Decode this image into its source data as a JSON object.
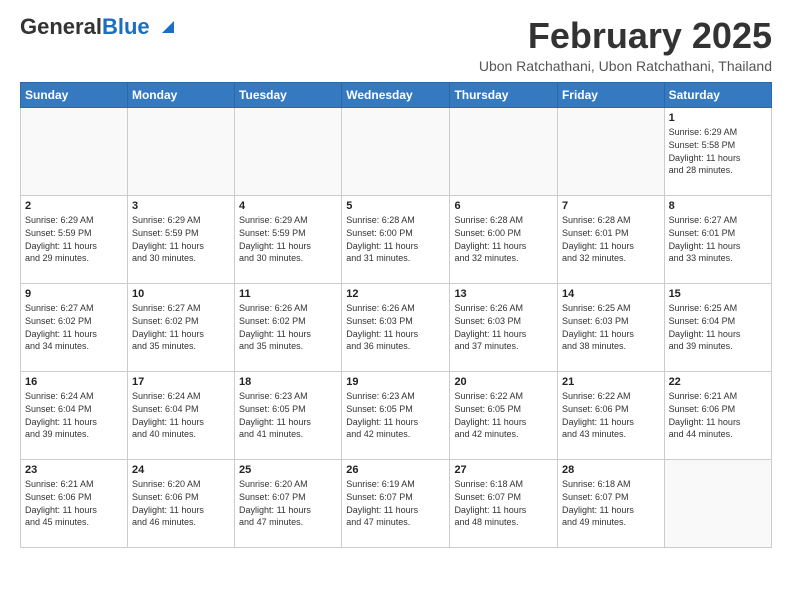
{
  "logo": {
    "general": "General",
    "blue": "Blue"
  },
  "title": "February 2025",
  "subtitle": "Ubon Ratchathani, Ubon Ratchathani, Thailand",
  "weekdays": [
    "Sunday",
    "Monday",
    "Tuesday",
    "Wednesday",
    "Thursday",
    "Friday",
    "Saturday"
  ],
  "weeks": [
    [
      {
        "day": "",
        "info": ""
      },
      {
        "day": "",
        "info": ""
      },
      {
        "day": "",
        "info": ""
      },
      {
        "day": "",
        "info": ""
      },
      {
        "day": "",
        "info": ""
      },
      {
        "day": "",
        "info": ""
      },
      {
        "day": "1",
        "info": "Sunrise: 6:29 AM\nSunset: 5:58 PM\nDaylight: 11 hours\nand 28 minutes."
      }
    ],
    [
      {
        "day": "2",
        "info": "Sunrise: 6:29 AM\nSunset: 5:59 PM\nDaylight: 11 hours\nand 29 minutes."
      },
      {
        "day": "3",
        "info": "Sunrise: 6:29 AM\nSunset: 5:59 PM\nDaylight: 11 hours\nand 30 minutes."
      },
      {
        "day": "4",
        "info": "Sunrise: 6:29 AM\nSunset: 5:59 PM\nDaylight: 11 hours\nand 30 minutes."
      },
      {
        "day": "5",
        "info": "Sunrise: 6:28 AM\nSunset: 6:00 PM\nDaylight: 11 hours\nand 31 minutes."
      },
      {
        "day": "6",
        "info": "Sunrise: 6:28 AM\nSunset: 6:00 PM\nDaylight: 11 hours\nand 32 minutes."
      },
      {
        "day": "7",
        "info": "Sunrise: 6:28 AM\nSunset: 6:01 PM\nDaylight: 11 hours\nand 32 minutes."
      },
      {
        "day": "8",
        "info": "Sunrise: 6:27 AM\nSunset: 6:01 PM\nDaylight: 11 hours\nand 33 minutes."
      }
    ],
    [
      {
        "day": "9",
        "info": "Sunrise: 6:27 AM\nSunset: 6:02 PM\nDaylight: 11 hours\nand 34 minutes."
      },
      {
        "day": "10",
        "info": "Sunrise: 6:27 AM\nSunset: 6:02 PM\nDaylight: 11 hours\nand 35 minutes."
      },
      {
        "day": "11",
        "info": "Sunrise: 6:26 AM\nSunset: 6:02 PM\nDaylight: 11 hours\nand 35 minutes."
      },
      {
        "day": "12",
        "info": "Sunrise: 6:26 AM\nSunset: 6:03 PM\nDaylight: 11 hours\nand 36 minutes."
      },
      {
        "day": "13",
        "info": "Sunrise: 6:26 AM\nSunset: 6:03 PM\nDaylight: 11 hours\nand 37 minutes."
      },
      {
        "day": "14",
        "info": "Sunrise: 6:25 AM\nSunset: 6:03 PM\nDaylight: 11 hours\nand 38 minutes."
      },
      {
        "day": "15",
        "info": "Sunrise: 6:25 AM\nSunset: 6:04 PM\nDaylight: 11 hours\nand 39 minutes."
      }
    ],
    [
      {
        "day": "16",
        "info": "Sunrise: 6:24 AM\nSunset: 6:04 PM\nDaylight: 11 hours\nand 39 minutes."
      },
      {
        "day": "17",
        "info": "Sunrise: 6:24 AM\nSunset: 6:04 PM\nDaylight: 11 hours\nand 40 minutes."
      },
      {
        "day": "18",
        "info": "Sunrise: 6:23 AM\nSunset: 6:05 PM\nDaylight: 11 hours\nand 41 minutes."
      },
      {
        "day": "19",
        "info": "Sunrise: 6:23 AM\nSunset: 6:05 PM\nDaylight: 11 hours\nand 42 minutes."
      },
      {
        "day": "20",
        "info": "Sunrise: 6:22 AM\nSunset: 6:05 PM\nDaylight: 11 hours\nand 42 minutes."
      },
      {
        "day": "21",
        "info": "Sunrise: 6:22 AM\nSunset: 6:06 PM\nDaylight: 11 hours\nand 43 minutes."
      },
      {
        "day": "22",
        "info": "Sunrise: 6:21 AM\nSunset: 6:06 PM\nDaylight: 11 hours\nand 44 minutes."
      }
    ],
    [
      {
        "day": "23",
        "info": "Sunrise: 6:21 AM\nSunset: 6:06 PM\nDaylight: 11 hours\nand 45 minutes."
      },
      {
        "day": "24",
        "info": "Sunrise: 6:20 AM\nSunset: 6:06 PM\nDaylight: 11 hours\nand 46 minutes."
      },
      {
        "day": "25",
        "info": "Sunrise: 6:20 AM\nSunset: 6:07 PM\nDaylight: 11 hours\nand 47 minutes."
      },
      {
        "day": "26",
        "info": "Sunrise: 6:19 AM\nSunset: 6:07 PM\nDaylight: 11 hours\nand 47 minutes."
      },
      {
        "day": "27",
        "info": "Sunrise: 6:18 AM\nSunset: 6:07 PM\nDaylight: 11 hours\nand 48 minutes."
      },
      {
        "day": "28",
        "info": "Sunrise: 6:18 AM\nSunset: 6:07 PM\nDaylight: 11 hours\nand 49 minutes."
      },
      {
        "day": "",
        "info": ""
      }
    ]
  ]
}
